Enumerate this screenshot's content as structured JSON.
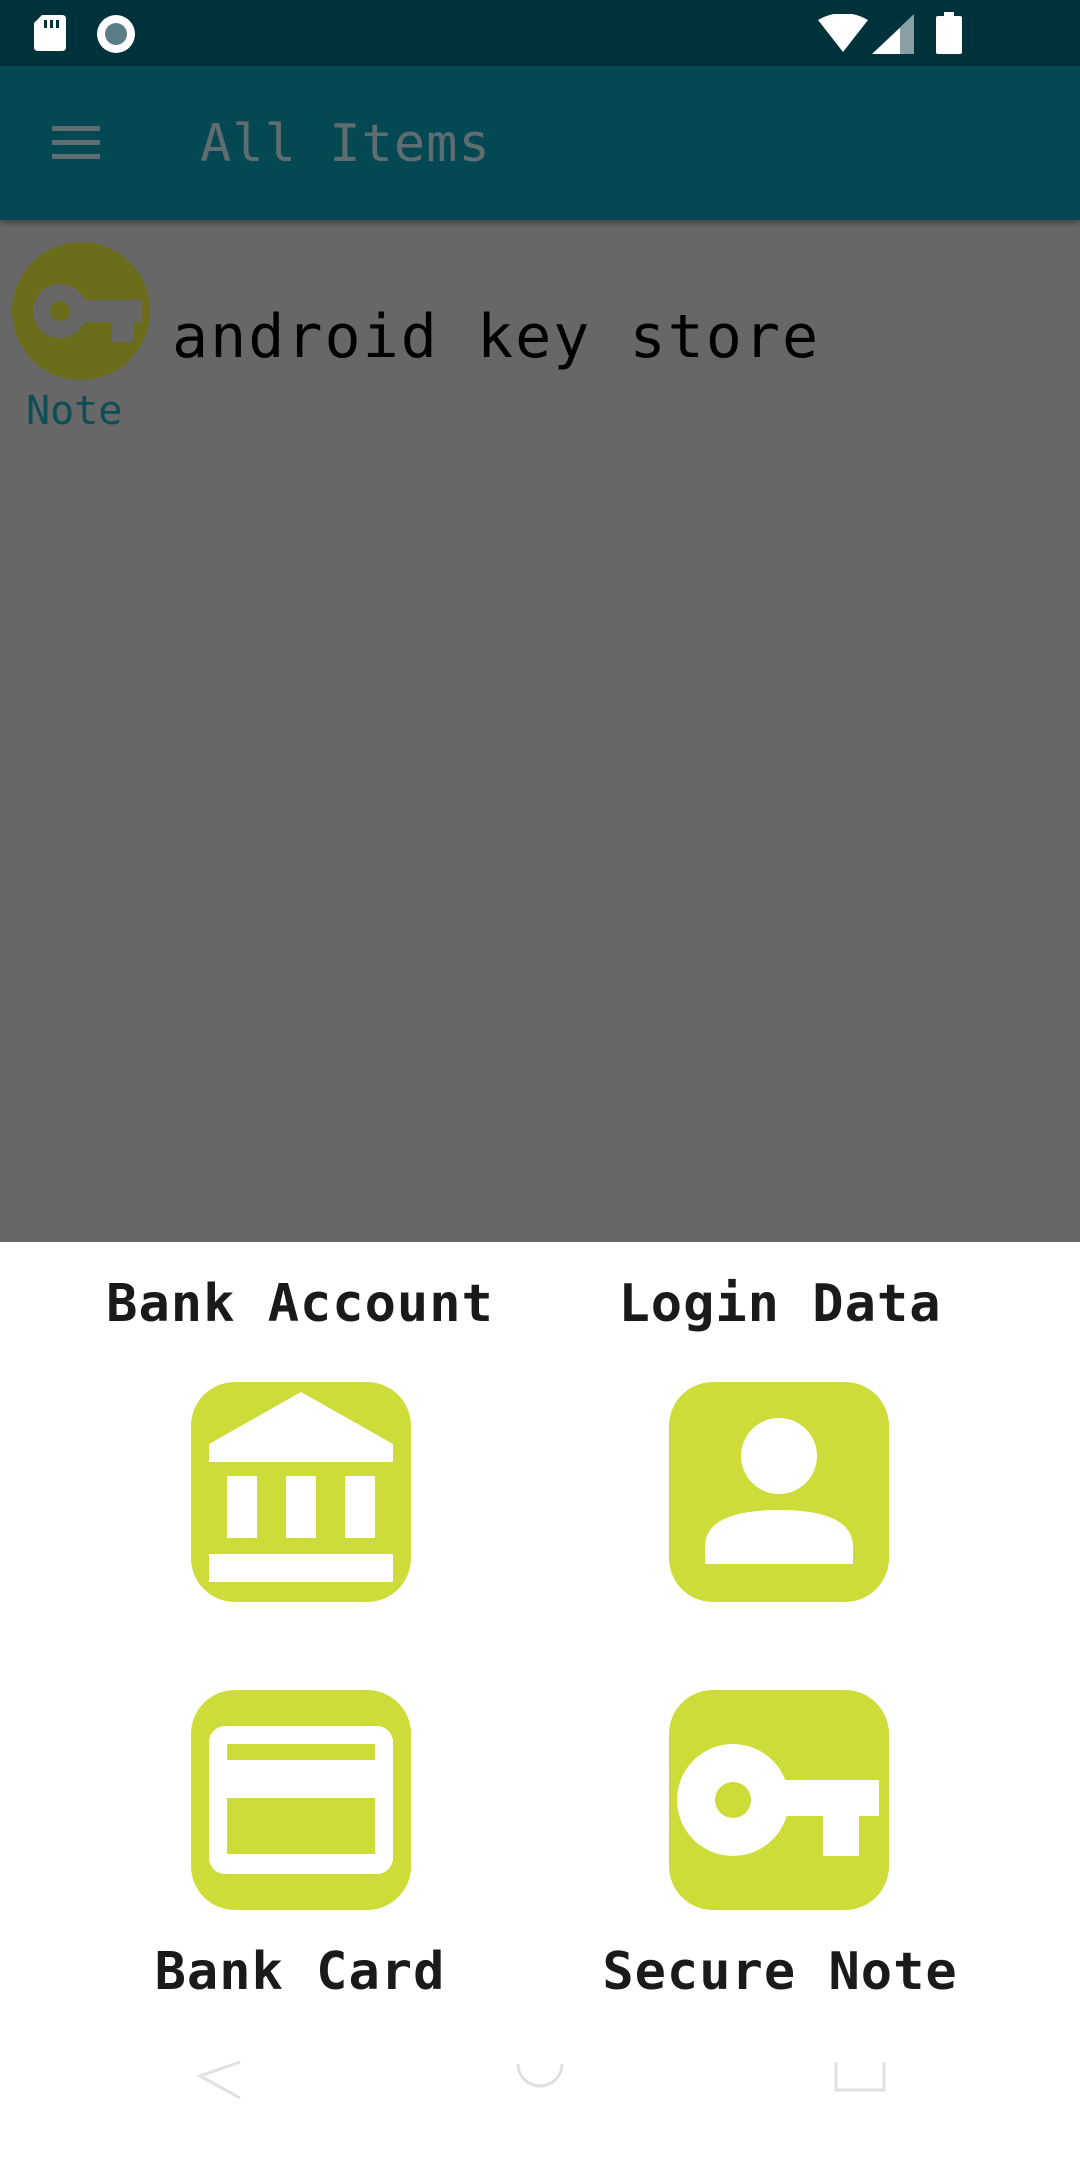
{
  "toolbar": {
    "title": "All Items",
    "menu_icon": "menu-icon"
  },
  "list": {
    "items": [
      {
        "title": "android key store",
        "type_label": "Note",
        "icon": "key-icon"
      }
    ]
  },
  "sheet": {
    "options": [
      {
        "label": "Bank Account",
        "icon": "bank-icon"
      },
      {
        "label": "Login Data",
        "icon": "person-icon"
      },
      {
        "label": "Bank Card",
        "icon": "credit-card-icon"
      },
      {
        "label": "Secure Note",
        "icon": "key-icon"
      }
    ]
  },
  "colors": {
    "accent": "#cddc39",
    "toolbar": "#034853",
    "status_bar": "#00323c",
    "scrim": "#676767"
  }
}
